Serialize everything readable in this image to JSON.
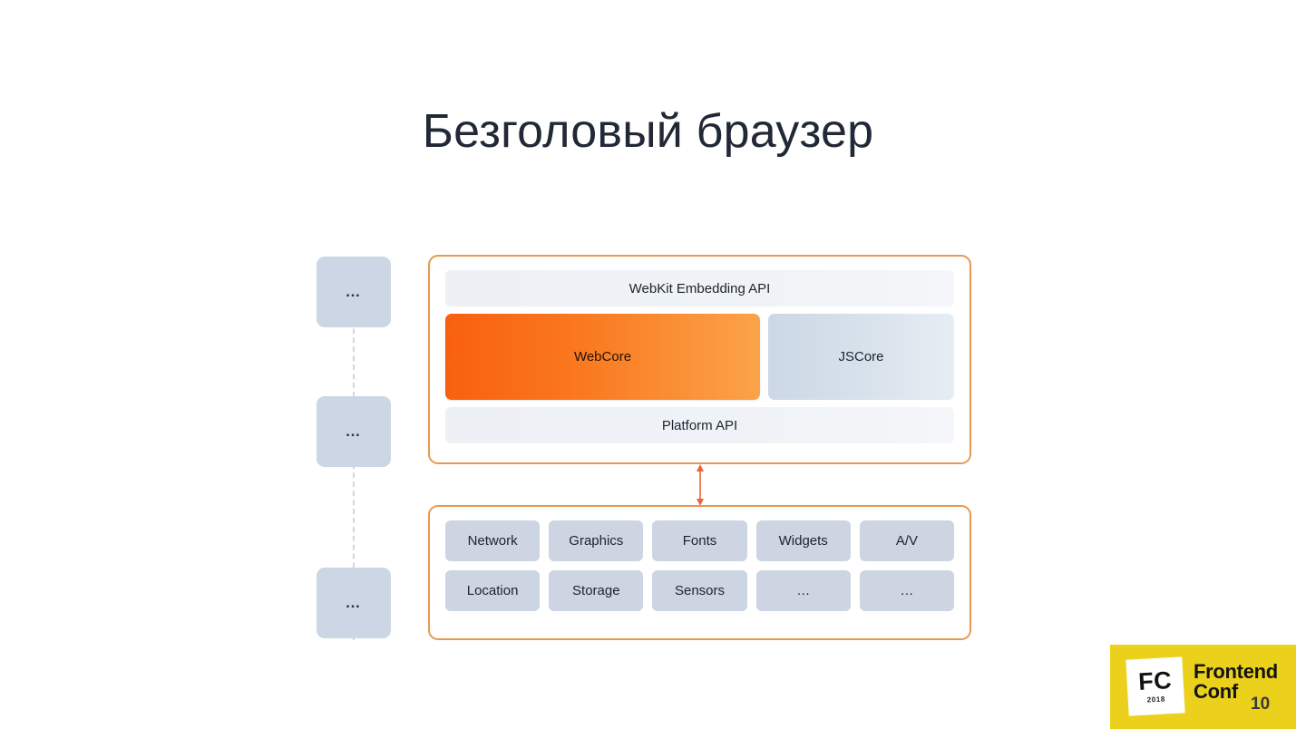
{
  "slide": {
    "title": "Безголовый браузер",
    "number": "10"
  },
  "side_column": {
    "boxes": [
      {
        "label": "…"
      },
      {
        "label": "…"
      },
      {
        "label": "…"
      }
    ]
  },
  "engine_panel": {
    "top_bar": "WebKit Embedding API",
    "webcore": "WebCore",
    "jscore": "JSCore",
    "bottom_bar": "Platform API"
  },
  "connector": {
    "kind": "double-headed-vertical-arrow"
  },
  "platform_panel": {
    "rows": [
      [
        "Network",
        "Graphics",
        "Fonts",
        "Widgets",
        "A/V"
      ],
      [
        "Location",
        "Storage",
        "Sensors",
        "…",
        "…"
      ]
    ]
  },
  "logo": {
    "badge_initials": "FC",
    "badge_year": "2018",
    "wordmark_line1": "Frontend",
    "wordmark_line2": "Conf"
  },
  "colors": {
    "title": "#212836",
    "panel_border": "#e59a52",
    "webcore_gradient_start": "#f8600f",
    "webcore_gradient_end": "#fba349",
    "jscore_gradient_start": "#ccd8e6",
    "jscore_gradient_end": "#e6edf4",
    "bar_background": "#eef1f5",
    "tile_background": "#ccd5e1",
    "side_box_background": "#ccd6e4",
    "logo_yellow": "#ebd11c",
    "arrow": "#e8643a"
  }
}
